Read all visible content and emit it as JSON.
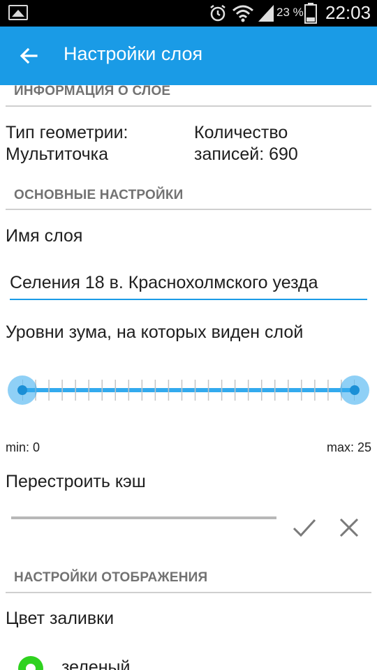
{
  "status_bar": {
    "battery_percent": "23 %",
    "time": "22:03",
    "icons": [
      "gallery-icon",
      "alarm-icon",
      "wifi-icon",
      "signal-icon",
      "battery-icon"
    ]
  },
  "app_bar": {
    "title": "Настройки слоя",
    "back_icon": "arrow-back-icon",
    "color": "#1a9be6"
  },
  "layer_info": {
    "header": "ИНФОРМАЦИЯ О СЛОЕ",
    "geometry_label": "Тип геометрии:",
    "geometry_value": "Мультиточка",
    "records_label": "Количество",
    "records_value": "записей: 690"
  },
  "basic_settings": {
    "header": "ОСНОВНЫЕ НАСТРОЙКИ",
    "layer_name_label": "Имя слоя",
    "layer_name_value": "Селения 18 в. Краснохолмского уезда",
    "zoom_label": "Уровни зума, на которых виден слой",
    "zoom_min_text": "min: 0",
    "zoom_max_text": "max: 25",
    "zoom_range": {
      "min": 0,
      "max": 25,
      "selected_low": 0,
      "selected_high": 25
    },
    "rebuild_cache_label": "Перестроить кэш",
    "confirm_icon": "check-icon",
    "cancel_icon": "close-icon"
  },
  "display_settings": {
    "header": "НАСТРОЙКИ ОТОБРАЖЕНИЯ",
    "fill_color_label": "Цвет заливки",
    "fill_color_value": "зеленый",
    "fill_color_hex": "#2fd21f"
  }
}
